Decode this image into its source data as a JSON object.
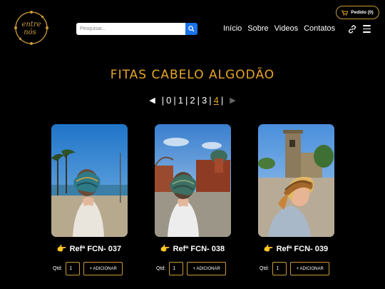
{
  "brand": {
    "logo_text": "entre nós"
  },
  "search": {
    "placeholder": "Pesquisar..."
  },
  "nav": {
    "items": [
      {
        "label": "Início"
      },
      {
        "label": "Sobre"
      },
      {
        "label": "Videos"
      },
      {
        "label": "Contatos"
      }
    ]
  },
  "cart": {
    "label": "Pedido (0)",
    "icon": "cart-icon"
  },
  "page": {
    "title": "FITAS CABELO ALGODÃO"
  },
  "pagination": {
    "prev": "◀",
    "next": "▶",
    "sep": "|",
    "pages": [
      "0",
      "1",
      "2",
      "3",
      "4"
    ],
    "active": "4"
  },
  "products": [
    {
      "ref": "Refª FCN- 037",
      "qty_label": "Qtd:",
      "qty": "1",
      "add_label": "+ ADICIONAR"
    },
    {
      "ref": "Refª FCN- 038",
      "qty_label": "Qtd:",
      "qty": "1",
      "add_label": "+ ADICIONAR"
    },
    {
      "ref": "Refª FCN- 039",
      "qty_label": "Qtd:",
      "qty": "1",
      "add_label": "+ ADICIONAR"
    }
  ],
  "icons": [
    "search-icon",
    "cart-icon",
    "link-icon",
    "menu-icon",
    "pointing-hand-icon"
  ],
  "colors": {
    "accent": "#e8a628",
    "border": "#c99a3b",
    "search_button": "#1a73e8",
    "background": "#000000"
  }
}
